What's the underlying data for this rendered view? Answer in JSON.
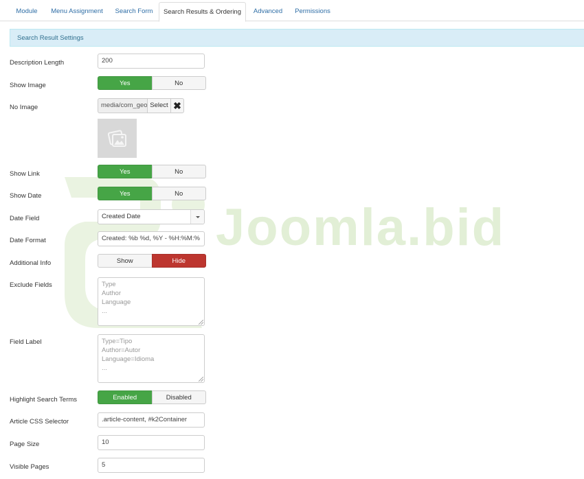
{
  "tabs": [
    {
      "label": "Module",
      "active": false
    },
    {
      "label": "Menu Assignment",
      "active": false
    },
    {
      "label": "Search Form",
      "active": false
    },
    {
      "label": "Search Results & Ordering",
      "active": true
    },
    {
      "label": "Advanced",
      "active": false
    },
    {
      "label": "Permissions",
      "active": false
    }
  ],
  "section_title": "Search Result Settings",
  "watermark": "Joomla.bid",
  "colors": {
    "accent_blue": "#2f6ea6",
    "toggle_on": "#46a546",
    "toggle_hide": "#bd362f",
    "header_bg": "#d9edf7",
    "header_text": "#31708f"
  },
  "fields": {
    "description_length": {
      "label": "Description Length",
      "value": "200"
    },
    "show_image": {
      "label": "Show Image",
      "on": "Yes",
      "off": "No",
      "selected": "Yes"
    },
    "no_image": {
      "label": "No Image",
      "path": "media/com_geo",
      "select_label": "Select",
      "clear_icon": "close-icon"
    },
    "show_link": {
      "label": "Show Link",
      "on": "Yes",
      "off": "No",
      "selected": "Yes"
    },
    "show_date": {
      "label": "Show Date",
      "on": "Yes",
      "off": "No",
      "selected": "Yes"
    },
    "date_field": {
      "label": "Date Field",
      "value": "Created Date"
    },
    "date_format": {
      "label": "Date Format",
      "value": "Created: %b %d, %Y - %H:%M:%"
    },
    "additional_info": {
      "label": "Additional Info",
      "on": "Show",
      "off": "Hide",
      "selected": "Hide"
    },
    "exclude_fields": {
      "label": "Exclude Fields",
      "lines": [
        "Type",
        "Author",
        "Language",
        "..."
      ]
    },
    "field_label": {
      "label": "Field Label",
      "lines": [
        "Type=Tipo",
        "Author=Autor",
        "Language=Idioma",
        "..."
      ]
    },
    "highlight_terms": {
      "label": "Highlight Search Terms",
      "on": "Enabled",
      "off": "Disabled",
      "selected": "Enabled"
    },
    "article_css_selector": {
      "label": "Article CSS Selector",
      "value": ".article-content, #k2Container"
    },
    "page_size": {
      "label": "Page Size",
      "value": "10"
    },
    "visible_pages": {
      "label": "Visible Pages",
      "value": "5"
    }
  }
}
